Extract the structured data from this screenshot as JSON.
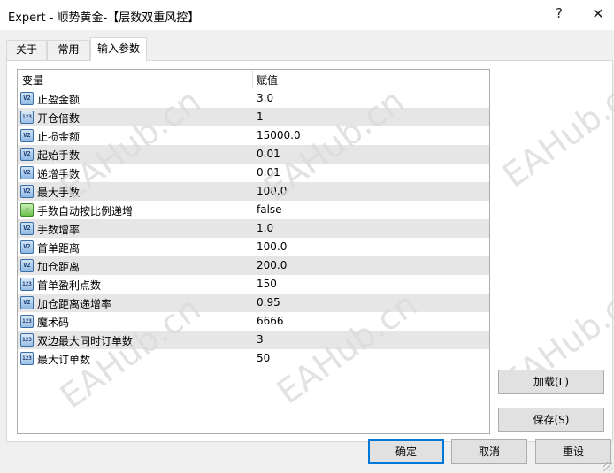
{
  "window": {
    "title": "Expert - 顺势黄金-【层数双重风控】",
    "help_glyph": "?",
    "close_glyph": "✕"
  },
  "tabs": [
    {
      "label": "关于"
    },
    {
      "label": "常用"
    },
    {
      "label": "输入参数"
    }
  ],
  "grid": {
    "col_variable": "变量",
    "col_value": "赋值",
    "rows": [
      {
        "icon": "double-value-icon",
        "name": "止盈金额",
        "value": "3.0"
      },
      {
        "icon": "integer-value-icon",
        "name": "开仓倍数",
        "value": "1"
      },
      {
        "icon": "double-value-icon",
        "name": "止损金额",
        "value": "15000.0"
      },
      {
        "icon": "double-value-icon",
        "name": "起始手数",
        "value": "0.01"
      },
      {
        "icon": "double-value-icon",
        "name": "递增手数",
        "value": "0.01"
      },
      {
        "icon": "double-value-icon",
        "name": "最大手数",
        "value": "100.0"
      },
      {
        "icon": "boolean-value-icon",
        "name": "手数自动按比例递增",
        "value": "false"
      },
      {
        "icon": "double-value-icon",
        "name": "手数增率",
        "value": "1.0"
      },
      {
        "icon": "double-value-icon",
        "name": "首单距离",
        "value": "100.0"
      },
      {
        "icon": "double-value-icon",
        "name": "加仓距离",
        "value": "200.0"
      },
      {
        "icon": "integer-value-icon",
        "name": "首单盈利点数",
        "value": "150"
      },
      {
        "icon": "double-value-icon",
        "name": "加仓距离递增率",
        "value": "0.95"
      },
      {
        "icon": "integer-value-icon",
        "name": "魔术码",
        "value": "6666"
      },
      {
        "icon": "integer-value-icon",
        "name": "双边最大同时订单数",
        "value": "3"
      },
      {
        "icon": "integer-value-icon",
        "name": "最大订单数",
        "value": "50"
      }
    ]
  },
  "buttons": {
    "load": "加载(L)",
    "save": "保存(S)",
    "ok": "确定",
    "cancel": "取消",
    "reset": "重设"
  },
  "watermark": "EAHub.cn",
  "colors": {
    "focus_border": "#0078d7",
    "row_alt": "#e6e6e6"
  }
}
